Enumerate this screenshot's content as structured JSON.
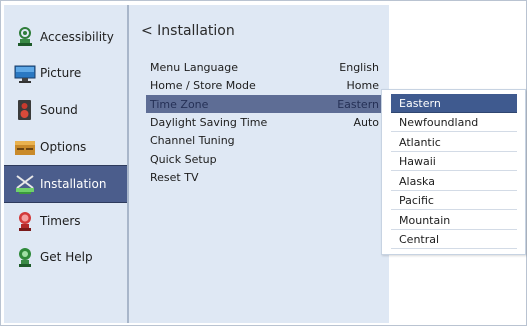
{
  "sidebar": {
    "items": [
      {
        "label": "Accessibility",
        "icon": "accessibility-icon"
      },
      {
        "label": "Picture",
        "icon": "picture-icon"
      },
      {
        "label": "Sound",
        "icon": "sound-icon"
      },
      {
        "label": "Options",
        "icon": "options-icon"
      },
      {
        "label": "Installation",
        "icon": "installation-icon",
        "active": true
      },
      {
        "label": "Timers",
        "icon": "timers-icon"
      },
      {
        "label": "Get Help",
        "icon": "get-help-icon"
      }
    ]
  },
  "main": {
    "title": "< Installation",
    "menu": [
      {
        "label": "Menu Language",
        "value": "English"
      },
      {
        "label": "Home / Store Mode",
        "value": "Home"
      },
      {
        "label": "Time Zone",
        "value": "Eastern",
        "selected": true
      },
      {
        "label": "Daylight Saving Time",
        "value": "Auto"
      },
      {
        "label": "Channel Tuning",
        "value": ""
      },
      {
        "label": "Quick Setup",
        "value": ""
      },
      {
        "label": "Reset TV",
        "value": ""
      }
    ]
  },
  "dropdown": {
    "options": [
      "Eastern",
      "Newfoundland",
      "Atlantic",
      "Hawaii",
      "Alaska",
      "Pacific",
      "Mountain",
      "Central"
    ],
    "selected": "Eastern"
  },
  "colors": {
    "panel": "#dfe8f4",
    "active_sidebar": "#4b5d8c",
    "selected_row": "#5e6d95",
    "dropdown_selected": "#3f5a8f"
  }
}
